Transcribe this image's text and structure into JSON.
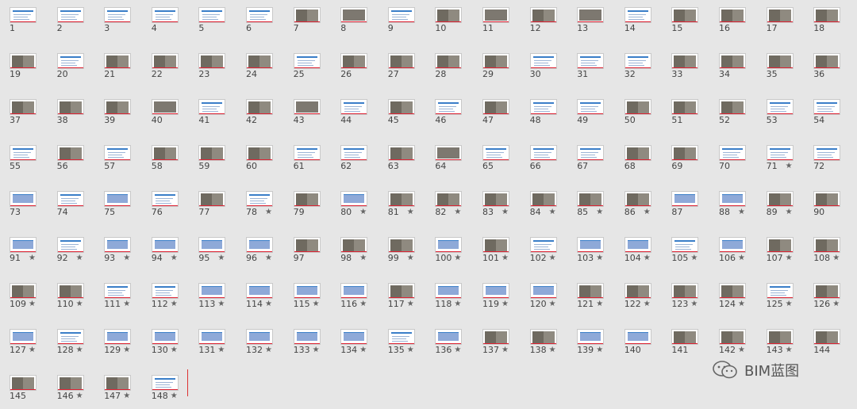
{
  "panel": {
    "watermark_text": "BIM蓝图",
    "watermark_icon": "wechat-icon"
  },
  "slides": [
    {
      "n": "1",
      "s": false,
      "t": "title"
    },
    {
      "n": "2",
      "s": false,
      "t": "text"
    },
    {
      "n": "3",
      "s": false,
      "t": "text"
    },
    {
      "n": "4",
      "s": false,
      "t": "text"
    },
    {
      "n": "5",
      "s": false,
      "t": "text"
    },
    {
      "n": "6",
      "s": false,
      "t": "text"
    },
    {
      "n": "7",
      "s": false,
      "t": "photo2"
    },
    {
      "n": "8",
      "s": false,
      "t": "photo"
    },
    {
      "n": "9",
      "s": false,
      "t": "text"
    },
    {
      "n": "10",
      "s": false,
      "t": "photo2"
    },
    {
      "n": "11",
      "s": false,
      "t": "photo"
    },
    {
      "n": "12",
      "s": false,
      "t": "photo2"
    },
    {
      "n": "13",
      "s": false,
      "t": "photo"
    },
    {
      "n": "14",
      "s": false,
      "t": "text"
    },
    {
      "n": "15",
      "s": false,
      "t": "photo2"
    },
    {
      "n": "16",
      "s": false,
      "t": "photo2"
    },
    {
      "n": "17",
      "s": false,
      "t": "photo2"
    },
    {
      "n": "18",
      "s": false,
      "t": "photo2"
    },
    {
      "n": "19",
      "s": false,
      "t": "photo2"
    },
    {
      "n": "20",
      "s": false,
      "t": "text"
    },
    {
      "n": "21",
      "s": false,
      "t": "photo2"
    },
    {
      "n": "22",
      "s": false,
      "t": "photo2"
    },
    {
      "n": "23",
      "s": false,
      "t": "photo2"
    },
    {
      "n": "24",
      "s": false,
      "t": "photo2"
    },
    {
      "n": "25",
      "s": false,
      "t": "text"
    },
    {
      "n": "26",
      "s": false,
      "t": "photo2"
    },
    {
      "n": "27",
      "s": false,
      "t": "photo2"
    },
    {
      "n": "28",
      "s": false,
      "t": "photo2"
    },
    {
      "n": "29",
      "s": false,
      "t": "photo2"
    },
    {
      "n": "30",
      "s": false,
      "t": "text"
    },
    {
      "n": "31",
      "s": false,
      "t": "text"
    },
    {
      "n": "32",
      "s": false,
      "t": "text"
    },
    {
      "n": "33",
      "s": false,
      "t": "photo2"
    },
    {
      "n": "34",
      "s": false,
      "t": "photo2"
    },
    {
      "n": "35",
      "s": false,
      "t": "photo2"
    },
    {
      "n": "36",
      "s": false,
      "t": "photo2"
    },
    {
      "n": "37",
      "s": false,
      "t": "photo2"
    },
    {
      "n": "38",
      "s": false,
      "t": "photo2"
    },
    {
      "n": "39",
      "s": false,
      "t": "photo2"
    },
    {
      "n": "40",
      "s": false,
      "t": "photo"
    },
    {
      "n": "41",
      "s": false,
      "t": "text"
    },
    {
      "n": "42",
      "s": false,
      "t": "photo2"
    },
    {
      "n": "43",
      "s": false,
      "t": "photo"
    },
    {
      "n": "44",
      "s": false,
      "t": "text"
    },
    {
      "n": "45",
      "s": false,
      "t": "photo2"
    },
    {
      "n": "46",
      "s": false,
      "t": "text"
    },
    {
      "n": "47",
      "s": false,
      "t": "photo2"
    },
    {
      "n": "48",
      "s": false,
      "t": "text"
    },
    {
      "n": "49",
      "s": false,
      "t": "text"
    },
    {
      "n": "50",
      "s": false,
      "t": "photo2"
    },
    {
      "n": "51",
      "s": false,
      "t": "photo2"
    },
    {
      "n": "52",
      "s": false,
      "t": "photo2"
    },
    {
      "n": "53",
      "s": false,
      "t": "text"
    },
    {
      "n": "54",
      "s": false,
      "t": "text"
    },
    {
      "n": "55",
      "s": false,
      "t": "text"
    },
    {
      "n": "56",
      "s": false,
      "t": "photo2"
    },
    {
      "n": "57",
      "s": false,
      "t": "text"
    },
    {
      "n": "58",
      "s": false,
      "t": "photo2"
    },
    {
      "n": "59",
      "s": false,
      "t": "photo2"
    },
    {
      "n": "60",
      "s": false,
      "t": "photo2"
    },
    {
      "n": "61",
      "s": false,
      "t": "text"
    },
    {
      "n": "62",
      "s": false,
      "t": "text"
    },
    {
      "n": "63",
      "s": false,
      "t": "photo2"
    },
    {
      "n": "64",
      "s": false,
      "t": "photo"
    },
    {
      "n": "65",
      "s": false,
      "t": "text"
    },
    {
      "n": "66",
      "s": false,
      "t": "text"
    },
    {
      "n": "67",
      "s": false,
      "t": "text"
    },
    {
      "n": "68",
      "s": false,
      "t": "photo2"
    },
    {
      "n": "69",
      "s": false,
      "t": "photo2"
    },
    {
      "n": "70",
      "s": false,
      "t": "text"
    },
    {
      "n": "71",
      "s": true,
      "t": "text"
    },
    {
      "n": "72",
      "s": false,
      "t": "text"
    },
    {
      "n": "73",
      "s": false,
      "t": "blue"
    },
    {
      "n": "74",
      "s": false,
      "t": "text"
    },
    {
      "n": "75",
      "s": false,
      "t": "blue"
    },
    {
      "n": "76",
      "s": false,
      "t": "text"
    },
    {
      "n": "77",
      "s": false,
      "t": "photo2"
    },
    {
      "n": "78",
      "s": true,
      "t": "text"
    },
    {
      "n": "79",
      "s": false,
      "t": "photo2"
    },
    {
      "n": "80",
      "s": true,
      "t": "blue"
    },
    {
      "n": "81",
      "s": true,
      "t": "photo2"
    },
    {
      "n": "82",
      "s": true,
      "t": "photo2"
    },
    {
      "n": "83",
      "s": true,
      "t": "photo2"
    },
    {
      "n": "84",
      "s": true,
      "t": "photo2"
    },
    {
      "n": "85",
      "s": true,
      "t": "photo2"
    },
    {
      "n": "86",
      "s": true,
      "t": "photo2"
    },
    {
      "n": "87",
      "s": false,
      "t": "blue"
    },
    {
      "n": "88",
      "s": true,
      "t": "blue"
    },
    {
      "n": "89",
      "s": true,
      "t": "photo2"
    },
    {
      "n": "90",
      "s": false,
      "t": "photo2"
    },
    {
      "n": "91",
      "s": true,
      "t": "blue"
    },
    {
      "n": "92",
      "s": true,
      "t": "text"
    },
    {
      "n": "93",
      "s": true,
      "t": "blue"
    },
    {
      "n": "94",
      "s": true,
      "t": "blue"
    },
    {
      "n": "95",
      "s": true,
      "t": "blue"
    },
    {
      "n": "96",
      "s": true,
      "t": "blue"
    },
    {
      "n": "97",
      "s": false,
      "t": "photo2"
    },
    {
      "n": "98",
      "s": true,
      "t": "photo2"
    },
    {
      "n": "99",
      "s": true,
      "t": "photo2"
    },
    {
      "n": "100",
      "s": true,
      "t": "blue"
    },
    {
      "n": "101",
      "s": true,
      "t": "photo2"
    },
    {
      "n": "102",
      "s": true,
      "t": "text"
    },
    {
      "n": "103",
      "s": true,
      "t": "blue"
    },
    {
      "n": "104",
      "s": true,
      "t": "blue"
    },
    {
      "n": "105",
      "s": true,
      "t": "text"
    },
    {
      "n": "106",
      "s": true,
      "t": "blue"
    },
    {
      "n": "107",
      "s": true,
      "t": "photo2"
    },
    {
      "n": "108",
      "s": true,
      "t": "photo2"
    },
    {
      "n": "109",
      "s": true,
      "t": "photo2"
    },
    {
      "n": "110",
      "s": true,
      "t": "photo2"
    },
    {
      "n": "111",
      "s": true,
      "t": "text"
    },
    {
      "n": "112",
      "s": true,
      "t": "text"
    },
    {
      "n": "113",
      "s": true,
      "t": "blue"
    },
    {
      "n": "114",
      "s": true,
      "t": "blue"
    },
    {
      "n": "115",
      "s": true,
      "t": "blue"
    },
    {
      "n": "116",
      "s": true,
      "t": "blue"
    },
    {
      "n": "117",
      "s": true,
      "t": "photo2"
    },
    {
      "n": "118",
      "s": true,
      "t": "blue"
    },
    {
      "n": "119",
      "s": true,
      "t": "blue"
    },
    {
      "n": "120",
      "s": true,
      "t": "blue"
    },
    {
      "n": "121",
      "s": true,
      "t": "photo2"
    },
    {
      "n": "122",
      "s": true,
      "t": "photo2"
    },
    {
      "n": "123",
      "s": true,
      "t": "photo2"
    },
    {
      "n": "124",
      "s": true,
      "t": "photo2"
    },
    {
      "n": "125",
      "s": true,
      "t": "text"
    },
    {
      "n": "126",
      "s": true,
      "t": "photo2"
    },
    {
      "n": "127",
      "s": true,
      "t": "blue"
    },
    {
      "n": "128",
      "s": true,
      "t": "text"
    },
    {
      "n": "129",
      "s": true,
      "t": "blue"
    },
    {
      "n": "130",
      "s": true,
      "t": "blue"
    },
    {
      "n": "131",
      "s": true,
      "t": "blue"
    },
    {
      "n": "132",
      "s": true,
      "t": "blue"
    },
    {
      "n": "133",
      "s": true,
      "t": "blue"
    },
    {
      "n": "134",
      "s": true,
      "t": "blue"
    },
    {
      "n": "135",
      "s": true,
      "t": "text"
    },
    {
      "n": "136",
      "s": true,
      "t": "blue"
    },
    {
      "n": "137",
      "s": true,
      "t": "photo2"
    },
    {
      "n": "138",
      "s": true,
      "t": "photo2"
    },
    {
      "n": "139",
      "s": true,
      "t": "blue"
    },
    {
      "n": "140",
      "s": false,
      "t": "blue"
    },
    {
      "n": "141",
      "s": false,
      "t": "photo2"
    },
    {
      "n": "142",
      "s": true,
      "t": "photo2"
    },
    {
      "n": "143",
      "s": true,
      "t": "photo2"
    },
    {
      "n": "144",
      "s": false,
      "t": "photo2"
    },
    {
      "n": "145",
      "s": false,
      "t": "photo2"
    },
    {
      "n": "146",
      "s": true,
      "t": "photo2"
    },
    {
      "n": "147",
      "s": true,
      "t": "photo2"
    },
    {
      "n": "148",
      "s": true,
      "t": "text"
    }
  ],
  "star_glyph": "★",
  "colors": {
    "background": "#e6e6e6",
    "accent_blue": "#3a7ec8",
    "accent_red": "#dd2233"
  }
}
